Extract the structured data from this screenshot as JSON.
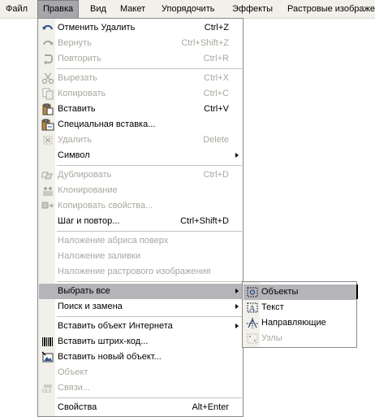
{
  "menubar": {
    "items": [
      {
        "label": "Файл"
      },
      {
        "label": "Правка",
        "active": true
      },
      {
        "label": "Вид"
      },
      {
        "label": "Макет"
      },
      {
        "label": "Упорядочить"
      },
      {
        "label": "Эффекты"
      },
      {
        "label": "Растровые изображе"
      }
    ]
  },
  "edit_menu": {
    "items": [
      {
        "label": "Отменить Удалить",
        "shortcut": "Ctrl+Z",
        "icon": "undo-icon",
        "enabled": true
      },
      {
        "label": "Вернуть",
        "shortcut": "Ctrl+Shift+Z",
        "icon": "redo-icon",
        "enabled": false
      },
      {
        "label": "Повторить",
        "shortcut": "Ctrl+R",
        "icon": "repeat-icon",
        "enabled": false
      },
      {
        "label": "Вырезать",
        "shortcut": "Ctrl+X",
        "icon": "scissors-icon",
        "enabled": false
      },
      {
        "label": "Копировать",
        "shortcut": "Ctrl+C",
        "icon": "copy-icon",
        "enabled": false
      },
      {
        "label": "Вставить",
        "shortcut": "Ctrl+V",
        "icon": "paste-icon",
        "enabled": true
      },
      {
        "label": "Специальная вставка...",
        "shortcut": "",
        "icon": "paste-special-icon",
        "enabled": true
      },
      {
        "label": "Удалить",
        "shortcut": "Delete",
        "icon": "delete-icon",
        "enabled": false
      },
      {
        "label": "Символ",
        "shortcut": "",
        "icon": "",
        "enabled": true,
        "submenu": true
      },
      {
        "label": "Дублировать",
        "shortcut": "Ctrl+D",
        "icon": "duplicate-icon",
        "enabled": false
      },
      {
        "label": "Клонирование",
        "shortcut": "",
        "icon": "clone-icon",
        "enabled": false
      },
      {
        "label": "Копировать свойства...",
        "shortcut": "",
        "icon": "copy-properties-icon",
        "enabled": false
      },
      {
        "label": "Шаг и повтор...",
        "shortcut": "Ctrl+Shift+D",
        "icon": "",
        "enabled": true
      },
      {
        "label": "Наложение абриса поверх",
        "shortcut": "",
        "icon": "",
        "enabled": false
      },
      {
        "label": "Наложение заливки",
        "shortcut": "",
        "icon": "",
        "enabled": false
      },
      {
        "label": "Наложение растрового изображения",
        "shortcut": "",
        "icon": "",
        "enabled": false
      },
      {
        "label": "Выбрать все",
        "shortcut": "",
        "icon": "",
        "enabled": true,
        "submenu": true,
        "highlighted": true
      },
      {
        "label": "Поиск и замена",
        "shortcut": "",
        "icon": "",
        "enabled": true,
        "submenu": true
      },
      {
        "label": "Вставить объект Интернета",
        "shortcut": "",
        "icon": "",
        "enabled": true,
        "submenu": true
      },
      {
        "label": "Вставить штрих-код...",
        "shortcut": "",
        "icon": "barcode-icon",
        "enabled": true
      },
      {
        "label": "Вставить новый объект...",
        "shortcut": "",
        "icon": "insert-object-icon",
        "enabled": true
      },
      {
        "label": "Объект",
        "shortcut": "",
        "icon": "",
        "enabled": false
      },
      {
        "label": "Связи...",
        "shortcut": "",
        "icon": "ole-links-icon",
        "enabled": false
      },
      {
        "label": "Свойства",
        "shortcut": "Alt+Enter",
        "icon": "",
        "enabled": true
      }
    ]
  },
  "select_all_submenu": {
    "items": [
      {
        "label": "Объекты",
        "icon": "select-objects-icon",
        "enabled": true,
        "highlighted": true
      },
      {
        "label": "Текст",
        "icon": "select-text-icon",
        "enabled": true
      },
      {
        "label": "Направляющие",
        "icon": "select-guidelines-icon",
        "enabled": true
      },
      {
        "label": "Узлы",
        "icon": "select-nodes-icon",
        "enabled": false
      }
    ]
  },
  "colors": {
    "menu_background": "#ffffff",
    "gutter": "#f2f0ea",
    "highlight": "#b5b4b8",
    "disabled_text": "#a8a79f"
  }
}
